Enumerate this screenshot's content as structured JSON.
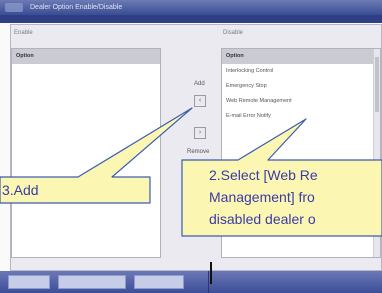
{
  "window": {
    "title": "Dealer Option Enable/Disable"
  },
  "enable_group": {
    "label": "Enable",
    "items": [
      {
        "label": "Option",
        "selected": true
      }
    ]
  },
  "disable_group": {
    "label": "Disable",
    "items": [
      {
        "label": "Option",
        "selected": true
      },
      {
        "label": "Interlocking Control",
        "selected": false
      },
      {
        "label": "Emergency Stop",
        "selected": false
      },
      {
        "label": "Web Remote Management",
        "selected": false
      },
      {
        "label": "E-mail Error Notify",
        "selected": false
      }
    ]
  },
  "buttons": {
    "add_label": "Add",
    "remove_label": "Remove"
  },
  "callouts": {
    "add": "3.Add",
    "select": [
      "2.Select [Web Re",
      "Management] fro",
      "disabled dealer o"
    ]
  },
  "colors": {
    "callout_fill": "#fbf7b3",
    "callout_border": "#3b5db0",
    "callout_text": "#3a3aa8",
    "titlebar": "#3a4c93"
  }
}
